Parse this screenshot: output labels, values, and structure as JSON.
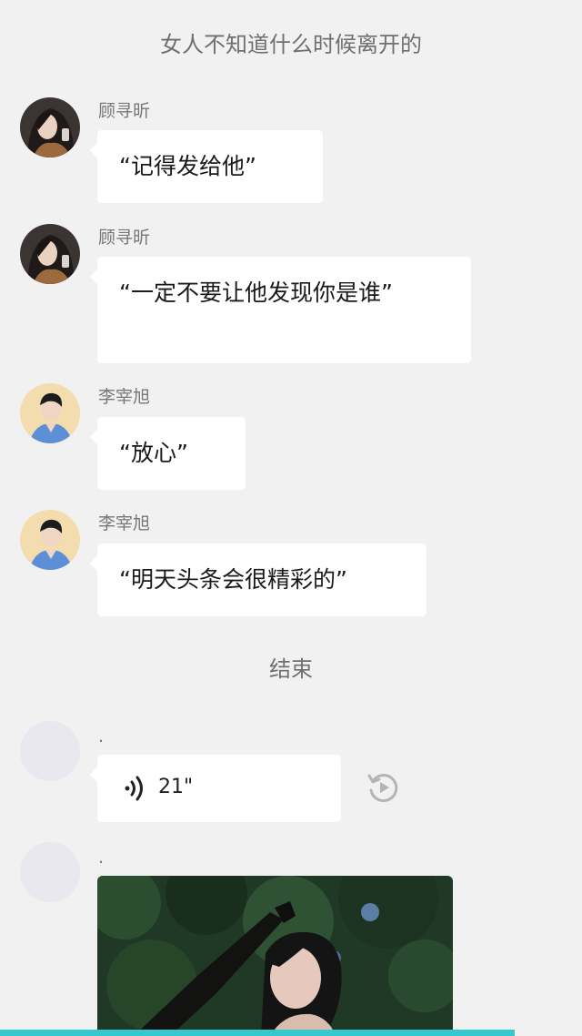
{
  "story": {
    "intro_narration": "女人不知道什么时候离开的",
    "end_narration": "结束"
  },
  "messages": [
    {
      "sender": "顾寻昕",
      "avatar": "woman-avatar",
      "text": "“记得发给他”"
    },
    {
      "sender": "顾寻昕",
      "avatar": "woman-avatar",
      "text": "“一定不要让他发现你是谁”"
    },
    {
      "sender": "李宰旭",
      "avatar": "man-avatar",
      "text": "“放心”"
    },
    {
      "sender": "李宰旭",
      "avatar": "man-avatar",
      "text": "“明天头条会很精彩的”"
    }
  ],
  "after_end": [
    {
      "sender": ".",
      "type": "voice",
      "duration": "21\"",
      "icon": "voice-wave-icon",
      "replay_icon": "replay-icon"
    },
    {
      "sender": ".",
      "type": "image",
      "description_icon": "photo-image"
    }
  ],
  "colors": {
    "background": "#f1f1f1",
    "bubble": "#ffffff",
    "accent_bar": "#35c8cf",
    "narration_text": "#6f6f6f"
  }
}
